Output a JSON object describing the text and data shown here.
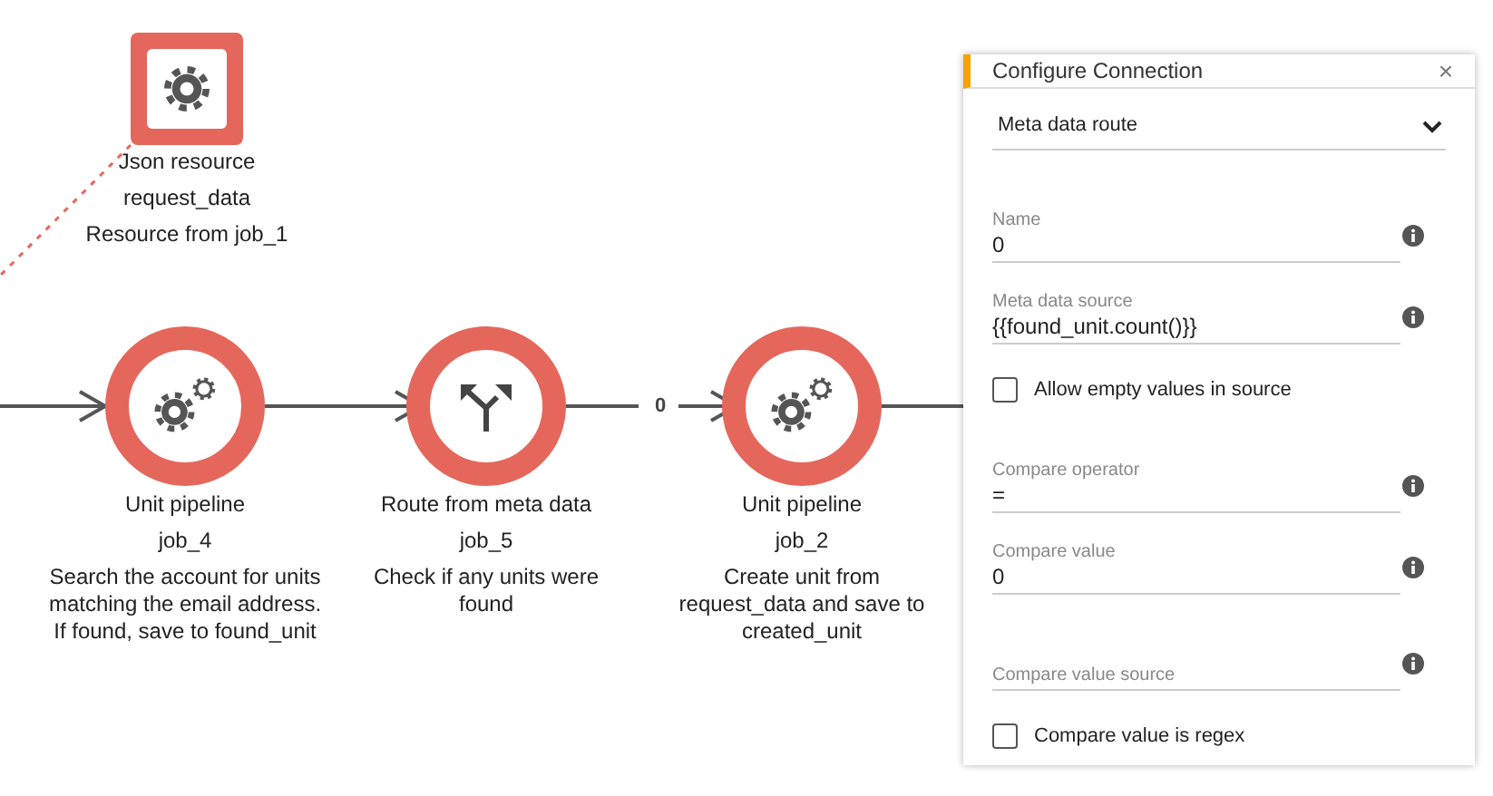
{
  "canvas": {
    "resource": {
      "kind": "resource",
      "title": "Json resource",
      "name": "request_data",
      "description": "Resource from job_1"
    },
    "nodes": [
      {
        "kind": "pipeline",
        "title": "Unit pipeline",
        "name": "job_4",
        "description": "Search the account for units matching the email address. If found, save to found_unit"
      },
      {
        "kind": "route",
        "title": "Route from meta data",
        "name": "job_5",
        "description": "Check if any units were found"
      },
      {
        "kind": "pipeline",
        "title": "Unit pipeline",
        "name": "job_2",
        "description": "Create unit from request_data and save to created_unit"
      }
    ],
    "connection_label": "0"
  },
  "panel": {
    "title": "Configure Connection",
    "close": "×",
    "type_select": "Meta data route",
    "fields": [
      {
        "kind": "field",
        "label": "Name",
        "value": "0"
      },
      {
        "kind": "field",
        "label": "Meta data source",
        "value": "{{found_unit.count()}}"
      },
      {
        "kind": "checkbox",
        "label": "Allow empty values in source",
        "checked": false
      },
      {
        "kind": "field",
        "label": "Compare operator",
        "value": "="
      },
      {
        "kind": "field",
        "label": "Compare value",
        "value": "0"
      },
      {
        "kind": "empty_field",
        "placeholder": "Compare value source"
      },
      {
        "kind": "checkbox",
        "label": "Compare value is regex",
        "checked": false
      }
    ]
  }
}
